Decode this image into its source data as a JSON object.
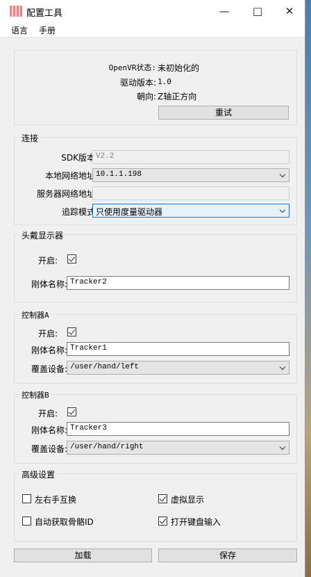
{
  "window": {
    "title": "配置工具",
    "minimize": "—",
    "maximize": "□",
    "close": "✕"
  },
  "menu": {
    "language": "语言",
    "manual": "手册"
  },
  "status": {
    "openvr_label": "OpenVR状态:",
    "openvr_value": "未初始化的",
    "driver_label": "驱动版本:",
    "driver_value": "1.0",
    "orient_label": "朝向:",
    "orient_value": "Z轴正方向",
    "reset_button": "重试"
  },
  "connection": {
    "legend": "连接",
    "sdk_label": "SDK版本:",
    "sdk_value": "V2.2",
    "local_label": "本地网络地址:",
    "local_value": "10.1.1.198",
    "server_label": "服务器网络地址:",
    "server_value": "",
    "mode_label": "追踪模式:",
    "mode_value": "只使用度量驱动器"
  },
  "hmd": {
    "legend": "头戴显示器",
    "enable_label": "开启:",
    "enabled": true,
    "rigid_label": "刚体名称:",
    "rigid_value": "Tracker2"
  },
  "controller_a": {
    "legend": "控制器A",
    "enable_label": "开启:",
    "enabled": true,
    "rigid_label": "刚体名称:",
    "rigid_value": "Tracker1",
    "override_label": "覆盖设备:",
    "override_value": "/user/hand/left"
  },
  "controller_b": {
    "legend": "控制器B",
    "enable_label": "开启:",
    "enabled": true,
    "rigid_label": "刚体名称:",
    "rigid_value": "Tracker3",
    "override_label": "覆盖设备:",
    "override_value": "/user/hand/right"
  },
  "advanced": {
    "legend": "高级设置",
    "swap_hands": "左右手互换",
    "swap_hands_checked": false,
    "virtual_display": "虚拟显示",
    "virtual_display_checked": true,
    "auto_bone": "自动获取骨骼ID",
    "auto_bone_checked": false,
    "keyboard_input": "打开键盘输入",
    "keyboard_input_checked": true
  },
  "footer": {
    "load_button": "加载",
    "save_button": "保存"
  }
}
